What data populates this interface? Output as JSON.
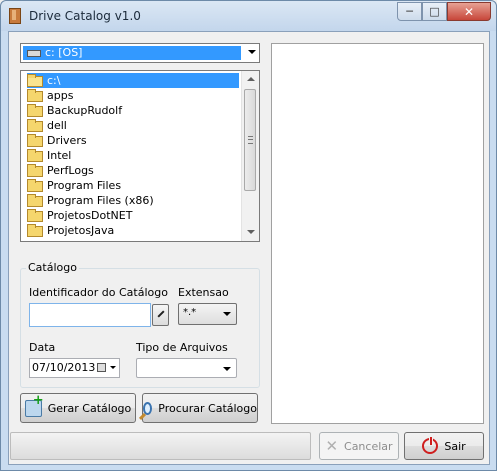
{
  "window": {
    "title": "Drive Catalog v1.0",
    "controls": {
      "minimize": "─",
      "maximize": "□",
      "close": "✕"
    }
  },
  "drive_select": {
    "value": "c: [OS]",
    "icon": "drive-icon"
  },
  "folder_tree": {
    "root": "c:\\",
    "items": [
      "apps",
      "BackupRudolf",
      "dell",
      "Drivers",
      "Intel",
      "PerfLogs",
      "Program Files",
      "Program Files (x86)",
      "ProjetosDotNET",
      "ProjetosJava"
    ]
  },
  "catalog_group": {
    "title": "Catálogo",
    "identifier_label": "Identificador do Catálogo",
    "identifier_value": "",
    "extension_label": "Extensao",
    "extension_value": "*.*",
    "date_label": "Data",
    "date_value": "07/10/2013",
    "file_type_label": "Tipo de Arquivos",
    "file_type_value": ""
  },
  "buttons": {
    "generate": "Gerar Catálogo",
    "search": "Procurar Catálogo",
    "cancel": "Cancelar",
    "exit": "Sair"
  },
  "colors": {
    "selection": "#3399ff",
    "window_frame": "#c9dcf0",
    "close_button": "#c7463a"
  }
}
